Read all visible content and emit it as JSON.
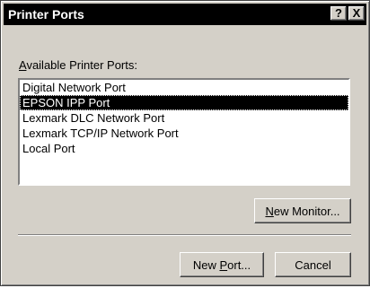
{
  "window": {
    "title": "Printer Ports",
    "help_label": "?",
    "close_label": "X"
  },
  "ports_list": {
    "label_underlined": "A",
    "label_rest": "vailable Printer Ports:",
    "items": [
      {
        "label": "Digital Network Port",
        "selected": false
      },
      {
        "label": "EPSON IPP Port",
        "selected": true
      },
      {
        "label": "Lexmark DLC Network Port",
        "selected": false
      },
      {
        "label": "Lexmark TCP/IP Network Port",
        "selected": false
      },
      {
        "label": "Local Port",
        "selected": false
      }
    ]
  },
  "buttons": {
    "new_monitor_ul": "N",
    "new_monitor_rest": "ew Monitor...",
    "new_port_pre": "New ",
    "new_port_ul": "P",
    "new_port_rest": "ort...",
    "cancel": "Cancel"
  }
}
